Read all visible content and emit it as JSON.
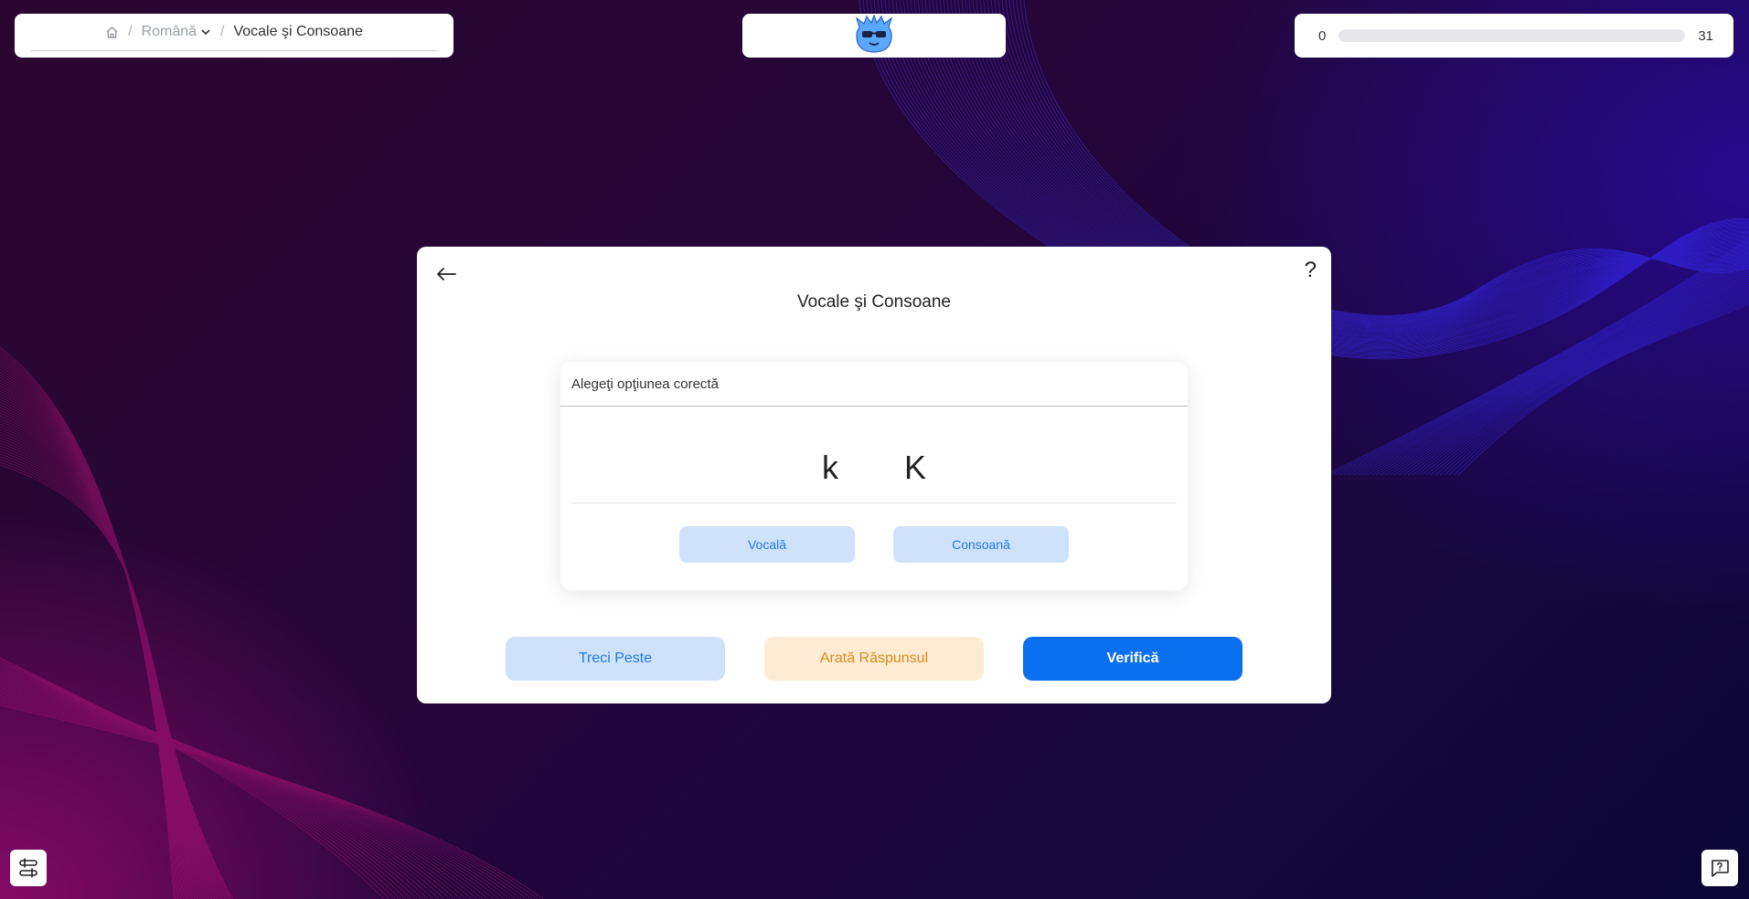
{
  "breadcrumb": {
    "home_icon": "home-icon",
    "separator": "/",
    "language": "Română",
    "current": "Vocale şi Consoane"
  },
  "logo": {
    "icon": "mascot-logo-icon"
  },
  "progress": {
    "current": "0",
    "total": "31",
    "fraction": 0
  },
  "card": {
    "title": "Vocale şi Consoane",
    "back_icon": "arrow-left-icon",
    "help_label": "?"
  },
  "question": {
    "prompt": "Alegeţi opţiunea corectă",
    "letters": [
      "k",
      "K"
    ],
    "options": [
      "Vocală",
      "Consoană"
    ]
  },
  "actions": {
    "skip": "Treci Peste",
    "show_answer": "Arată Răspunsul",
    "check": "Verifică"
  },
  "corner": {
    "settings_icon": "settings-sliders-icon",
    "feedback_icon": "chat-help-icon"
  },
  "colors": {
    "primary": "#0a6ff0",
    "primary_light": "#cfe2fb",
    "warning_light": "#fdecd3",
    "warning_text": "#d98b1a"
  }
}
